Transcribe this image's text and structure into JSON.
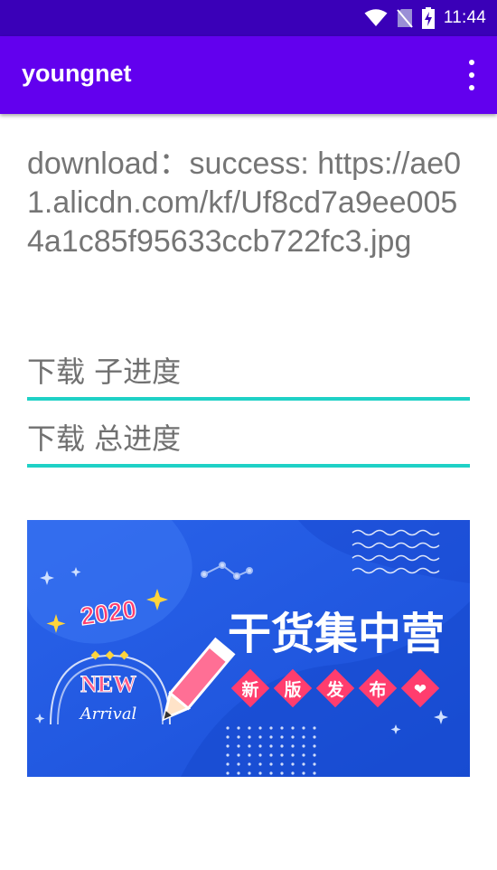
{
  "status_bar": {
    "time": "11:44",
    "icons": [
      "wifi-icon",
      "no-sim-icon",
      "battery-charging-icon"
    ]
  },
  "app_bar": {
    "title": "youngnet",
    "menu_icon": "overflow-menu-icon"
  },
  "download": {
    "status_text": "download：success: https://ae01.alicdn.com/kf/Uf8cd7a9ee0054a1c85f95633ccb722fc3.jpg"
  },
  "progress": {
    "sub": {
      "label": "下载 子进度",
      "value": 1.0
    },
    "total": {
      "label": "下载 总进度",
      "value": 1.0
    }
  },
  "banner": {
    "year": "2020",
    "headline": "干货集中营",
    "badge_new": "NEW",
    "badge_arrival": "Arrival",
    "tags": [
      "新",
      "版",
      "发",
      "布",
      "❤"
    ],
    "colors": {
      "background": "#1d5de6",
      "accent": "#ff3d6e",
      "star": "#ffd43b"
    }
  },
  "colors": {
    "status_bar": "#3a00b8",
    "app_bar": "#6200ee",
    "progress": "#1fd1c6"
  }
}
